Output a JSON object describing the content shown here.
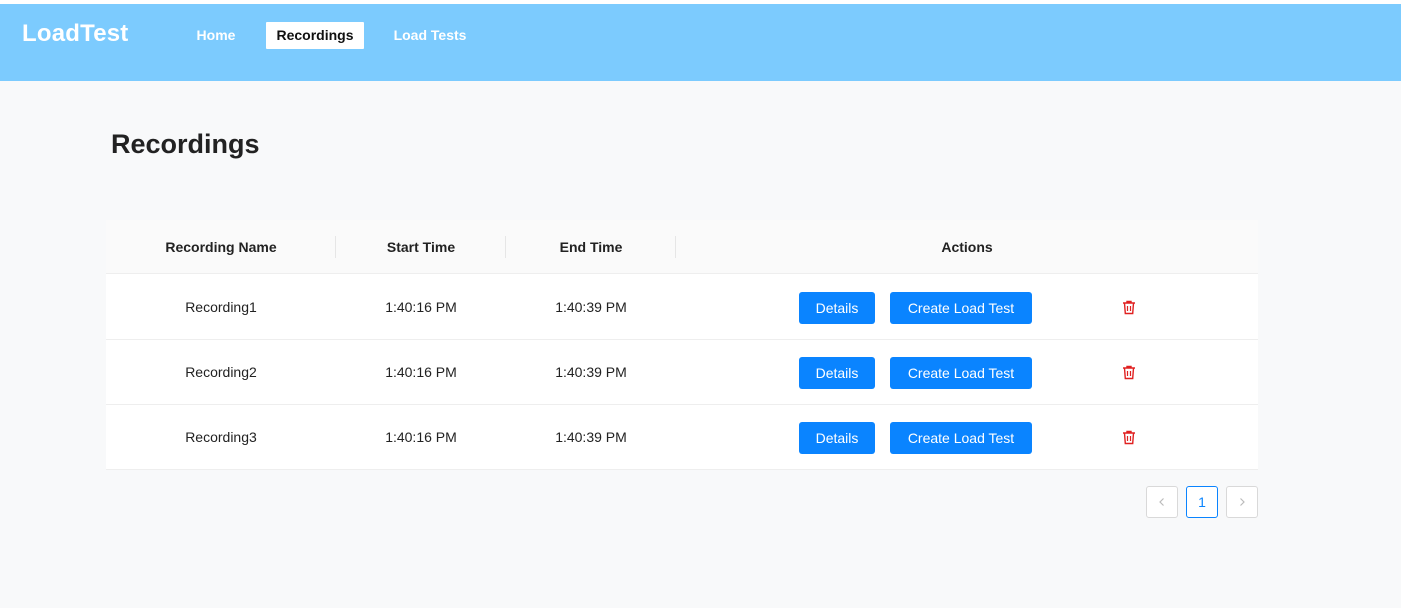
{
  "app": {
    "logo": "LoadTest"
  },
  "nav": {
    "items": [
      {
        "label": "Home",
        "active": false
      },
      {
        "label": "Recordings",
        "active": true
      },
      {
        "label": "Load Tests",
        "active": false
      }
    ]
  },
  "page": {
    "title": "Recordings"
  },
  "table": {
    "columns": [
      "Recording Name",
      "Start Time",
      "End Time",
      "Actions"
    ],
    "rows": [
      {
        "name": "Recording1",
        "start": "1:40:16 PM",
        "end": "1:40:39 PM"
      },
      {
        "name": "Recording2",
        "start": "1:40:16 PM",
        "end": "1:40:39 PM"
      },
      {
        "name": "Recording3",
        "start": "1:40:16 PM",
        "end": "1:40:39 PM"
      }
    ],
    "actions": {
      "details_label": "Details",
      "create_label": "Create Load Test",
      "delete_icon": "trash-icon"
    }
  },
  "pagination": {
    "prev_icon": "chevron-left-icon",
    "current_page": "1",
    "next_icon": "chevron-right-icon"
  },
  "colors": {
    "header": "#7ccbfe",
    "primary": "#0a84ff",
    "danger": "#e02020",
    "background": "#f8f9fa"
  }
}
